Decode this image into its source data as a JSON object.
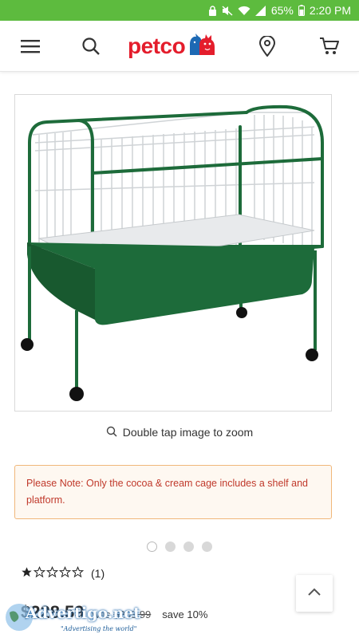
{
  "status_bar": {
    "battery": "65%",
    "time": "2:20 PM"
  },
  "header": {
    "logo_text": "petco",
    "menu_icon": "hamburger-menu-icon",
    "search_icon": "search-icon",
    "location_icon": "location-pin-icon",
    "cart_icon": "shopping-cart-icon"
  },
  "product": {
    "image_alt": "Green rabbit cage on stand with wheels",
    "zoom_hint": "Double tap image to zoom",
    "notice": "Please Note: Only the cocoa & cream cage includes a shelf and platform.",
    "carousel": {
      "count": 4,
      "active": 0
    },
    "rating": {
      "stars": 1,
      "max": 5,
      "count": "(1)"
    },
    "price": "$228.59",
    "was_label": "was",
    "was_price": "$253.99",
    "save": "save 10%"
  },
  "watermark": {
    "text": "Advertigo.net",
    "tagline": "\"Advertising the world\""
  },
  "colors": {
    "status_bar": "#5dbb3e",
    "brand_red": "#e41d2c",
    "brand_blue": "#1d69b4",
    "cage_green": "#1d6b3a",
    "notice_text": "#c0392b",
    "notice_border": "#f0b77a"
  }
}
